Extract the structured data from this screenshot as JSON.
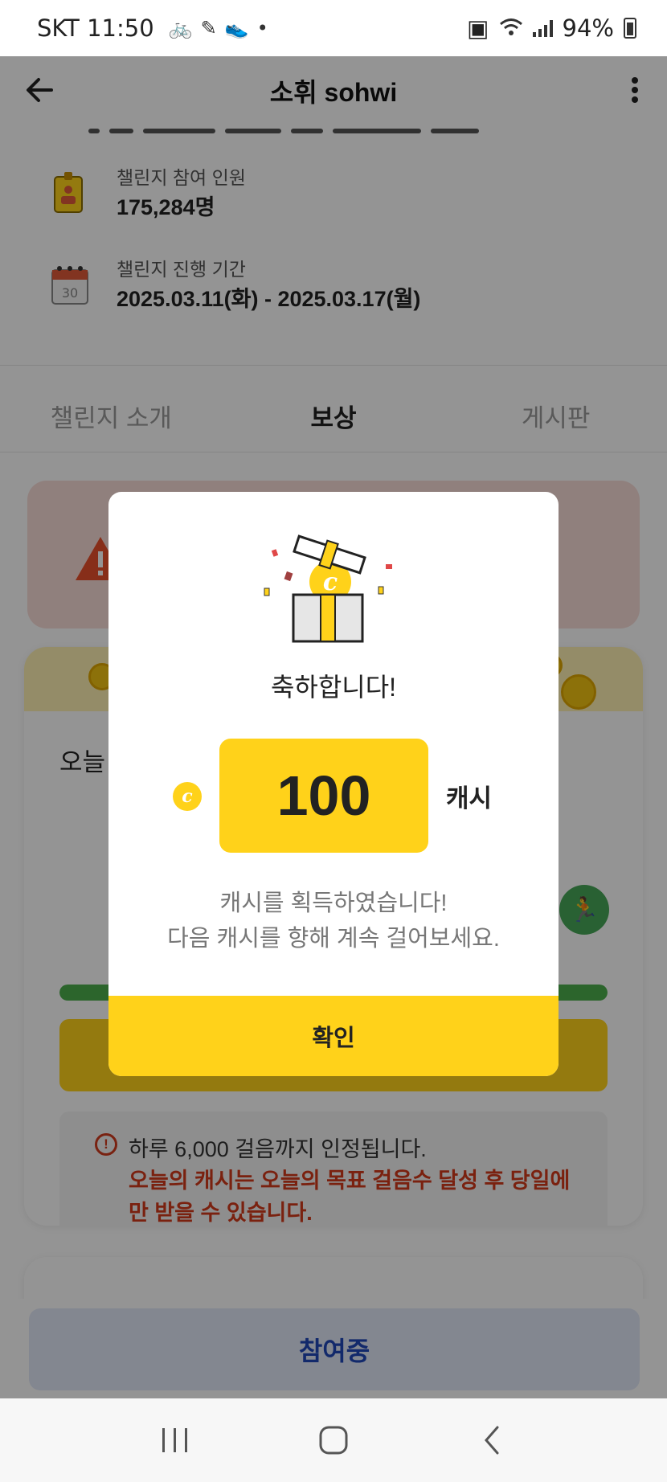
{
  "status_bar": {
    "carrier_time": "SKT 11:50",
    "dot": "•",
    "battery": "94%"
  },
  "header": {
    "title": "소휘 sohwi"
  },
  "info": [
    {
      "label": "챌린지 참여 인원",
      "value": "175,284명"
    },
    {
      "label": "챌린지 진행 기간",
      "value": "2025.03.11(화) - 2025.03.17(월)"
    }
  ],
  "tabs": [
    {
      "label": "챌린지 소개",
      "active": false
    },
    {
      "label": "보상",
      "active": true
    },
    {
      "label": "게시판",
      "active": false
    }
  ],
  "steps_card": {
    "today_label": "오늘",
    "progress": 1.0,
    "notice_line1": "하루 6,000 걸음까지 인정됩니다.",
    "notice_red": "오늘의 캐시는 오늘의 목표 걸음수 달성 후 당일에만 받을 수 있습니다."
  },
  "join_button": "참여중",
  "modal": {
    "title": "축하합니다!",
    "coin_symbol": "c",
    "amount": "100",
    "unit": "캐시",
    "message_line1": "캐시를 획득하였습니다!",
    "message_line2": "다음 캐시를 향해 계속 걸어보세요.",
    "confirm": "확인"
  },
  "colors": {
    "accent_yellow": "#ffd21a",
    "warning_red": "#d23a1a",
    "join_blue": "#1f47b8",
    "progress_green": "#4cae4c"
  }
}
